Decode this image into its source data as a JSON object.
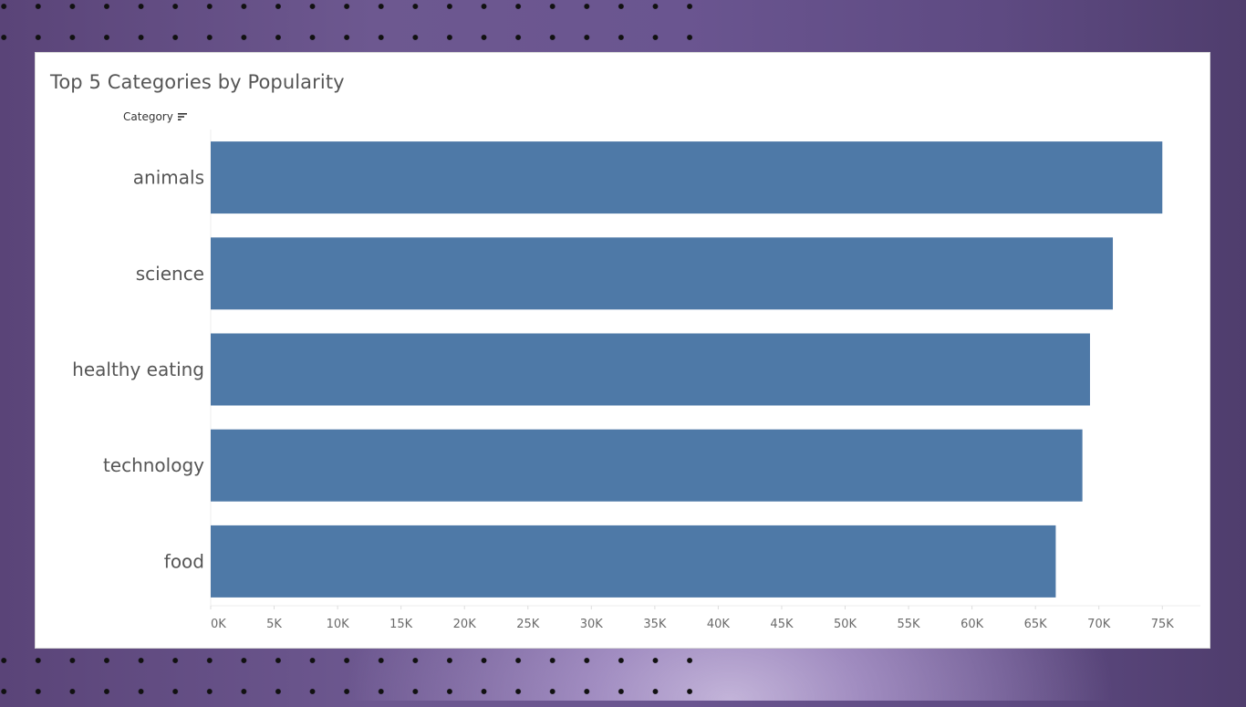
{
  "title": "Top 5 Categories by Popularity",
  "category_header": "Category",
  "icons": {
    "sort": "sort-descending-icon"
  },
  "colors": {
    "bar": "#4e79a7"
  },
  "chart_data": {
    "type": "bar",
    "orientation": "horizontal",
    "title": "Top 5 Categories by Popularity",
    "categories": [
      "animals",
      "science",
      "healthy eating",
      "technology",
      "food"
    ],
    "values": [
      75000,
      71100,
      69300,
      68700,
      66600
    ],
    "xlim": [
      0,
      78000
    ],
    "x_ticks": [
      0,
      5000,
      10000,
      15000,
      20000,
      25000,
      30000,
      35000,
      40000,
      45000,
      50000,
      55000,
      60000,
      65000,
      70000,
      75000
    ],
    "x_tick_labels": [
      "0K",
      "5K",
      "10K",
      "15K",
      "20K",
      "25K",
      "30K",
      "35K",
      "40K",
      "45K",
      "50K",
      "55K",
      "60K",
      "65K",
      "70K",
      "75K"
    ],
    "xlabel": "",
    "ylabel": "Category",
    "grid": false,
    "legend": "none"
  }
}
